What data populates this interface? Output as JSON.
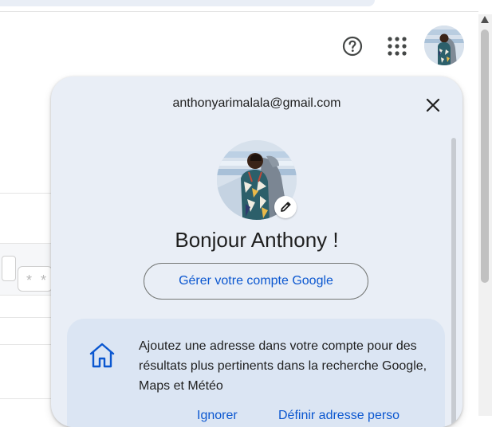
{
  "header": {
    "help_icon": "help-circle-icon",
    "apps_icon": "apps-grid-icon",
    "account_avatar": "profile-photo"
  },
  "account_panel": {
    "email": "anthonyarimalala@gmail.com",
    "close_icon": "close-icon",
    "greeting": "Bonjour Anthony !",
    "manage_account_label": "Gérer votre compte Google",
    "edit_icon": "pencil-icon"
  },
  "address_card": {
    "icon": "home-icon",
    "text": "Ajoutez une adresse dans votre compte pour des résultats plus pertinents dans la recherche Google, Maps et Météo",
    "ignore_label": "Ignorer",
    "define_label": "Définir adresse perso"
  },
  "background_page": {
    "input_mask": "* *"
  },
  "colors": {
    "panel_bg": "#e9eef6",
    "card_bg": "#dbe5f3",
    "link_blue": "#0b57d0",
    "outline": "#747775"
  }
}
